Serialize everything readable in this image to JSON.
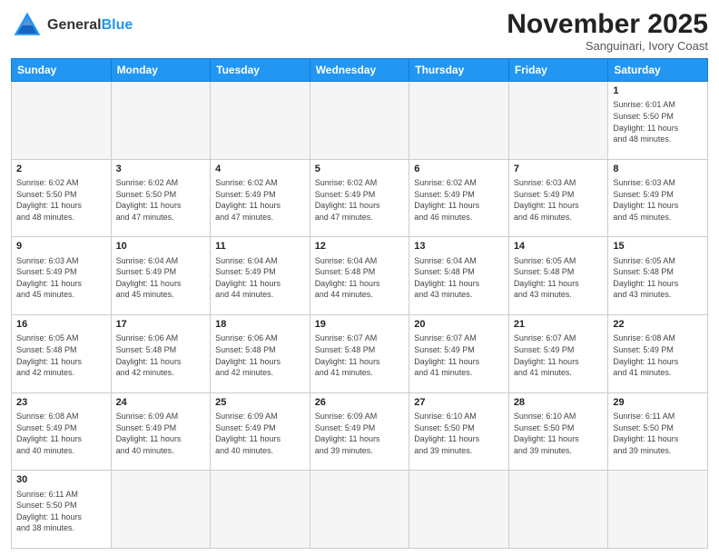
{
  "logo": {
    "general": "General",
    "blue": "Blue"
  },
  "header": {
    "month_title": "November 2025",
    "subtitle": "Sanguinari, Ivory Coast"
  },
  "days_of_week": [
    "Sunday",
    "Monday",
    "Tuesday",
    "Wednesday",
    "Thursday",
    "Friday",
    "Saturday"
  ],
  "weeks": [
    [
      {
        "day": "",
        "info": ""
      },
      {
        "day": "",
        "info": ""
      },
      {
        "day": "",
        "info": ""
      },
      {
        "day": "",
        "info": ""
      },
      {
        "day": "",
        "info": ""
      },
      {
        "day": "",
        "info": ""
      },
      {
        "day": "1",
        "info": "Sunrise: 6:01 AM\nSunset: 5:50 PM\nDaylight: 11 hours\nand 48 minutes."
      }
    ],
    [
      {
        "day": "2",
        "info": "Sunrise: 6:02 AM\nSunset: 5:50 PM\nDaylight: 11 hours\nand 48 minutes."
      },
      {
        "day": "3",
        "info": "Sunrise: 6:02 AM\nSunset: 5:50 PM\nDaylight: 11 hours\nand 47 minutes."
      },
      {
        "day": "4",
        "info": "Sunrise: 6:02 AM\nSunset: 5:49 PM\nDaylight: 11 hours\nand 47 minutes."
      },
      {
        "day": "5",
        "info": "Sunrise: 6:02 AM\nSunset: 5:49 PM\nDaylight: 11 hours\nand 47 minutes."
      },
      {
        "day": "6",
        "info": "Sunrise: 6:02 AM\nSunset: 5:49 PM\nDaylight: 11 hours\nand 46 minutes."
      },
      {
        "day": "7",
        "info": "Sunrise: 6:03 AM\nSunset: 5:49 PM\nDaylight: 11 hours\nand 46 minutes."
      },
      {
        "day": "8",
        "info": "Sunrise: 6:03 AM\nSunset: 5:49 PM\nDaylight: 11 hours\nand 45 minutes."
      }
    ],
    [
      {
        "day": "9",
        "info": "Sunrise: 6:03 AM\nSunset: 5:49 PM\nDaylight: 11 hours\nand 45 minutes."
      },
      {
        "day": "10",
        "info": "Sunrise: 6:04 AM\nSunset: 5:49 PM\nDaylight: 11 hours\nand 45 minutes."
      },
      {
        "day": "11",
        "info": "Sunrise: 6:04 AM\nSunset: 5:49 PM\nDaylight: 11 hours\nand 44 minutes."
      },
      {
        "day": "12",
        "info": "Sunrise: 6:04 AM\nSunset: 5:48 PM\nDaylight: 11 hours\nand 44 minutes."
      },
      {
        "day": "13",
        "info": "Sunrise: 6:04 AM\nSunset: 5:48 PM\nDaylight: 11 hours\nand 43 minutes."
      },
      {
        "day": "14",
        "info": "Sunrise: 6:05 AM\nSunset: 5:48 PM\nDaylight: 11 hours\nand 43 minutes."
      },
      {
        "day": "15",
        "info": "Sunrise: 6:05 AM\nSunset: 5:48 PM\nDaylight: 11 hours\nand 43 minutes."
      }
    ],
    [
      {
        "day": "16",
        "info": "Sunrise: 6:05 AM\nSunset: 5:48 PM\nDaylight: 11 hours\nand 42 minutes."
      },
      {
        "day": "17",
        "info": "Sunrise: 6:06 AM\nSunset: 5:48 PM\nDaylight: 11 hours\nand 42 minutes."
      },
      {
        "day": "18",
        "info": "Sunrise: 6:06 AM\nSunset: 5:48 PM\nDaylight: 11 hours\nand 42 minutes."
      },
      {
        "day": "19",
        "info": "Sunrise: 6:07 AM\nSunset: 5:48 PM\nDaylight: 11 hours\nand 41 minutes."
      },
      {
        "day": "20",
        "info": "Sunrise: 6:07 AM\nSunset: 5:49 PM\nDaylight: 11 hours\nand 41 minutes."
      },
      {
        "day": "21",
        "info": "Sunrise: 6:07 AM\nSunset: 5:49 PM\nDaylight: 11 hours\nand 41 minutes."
      },
      {
        "day": "22",
        "info": "Sunrise: 6:08 AM\nSunset: 5:49 PM\nDaylight: 11 hours\nand 41 minutes."
      }
    ],
    [
      {
        "day": "23",
        "info": "Sunrise: 6:08 AM\nSunset: 5:49 PM\nDaylight: 11 hours\nand 40 minutes."
      },
      {
        "day": "24",
        "info": "Sunrise: 6:09 AM\nSunset: 5:49 PM\nDaylight: 11 hours\nand 40 minutes."
      },
      {
        "day": "25",
        "info": "Sunrise: 6:09 AM\nSunset: 5:49 PM\nDaylight: 11 hours\nand 40 minutes."
      },
      {
        "day": "26",
        "info": "Sunrise: 6:09 AM\nSunset: 5:49 PM\nDaylight: 11 hours\nand 39 minutes."
      },
      {
        "day": "27",
        "info": "Sunrise: 6:10 AM\nSunset: 5:50 PM\nDaylight: 11 hours\nand 39 minutes."
      },
      {
        "day": "28",
        "info": "Sunrise: 6:10 AM\nSunset: 5:50 PM\nDaylight: 11 hours\nand 39 minutes."
      },
      {
        "day": "29",
        "info": "Sunrise: 6:11 AM\nSunset: 5:50 PM\nDaylight: 11 hours\nand 39 minutes."
      }
    ],
    [
      {
        "day": "30",
        "info": "Sunrise: 6:11 AM\nSunset: 5:50 PM\nDaylight: 11 hours\nand 38 minutes."
      },
      {
        "day": "",
        "info": ""
      },
      {
        "day": "",
        "info": ""
      },
      {
        "day": "",
        "info": ""
      },
      {
        "day": "",
        "info": ""
      },
      {
        "day": "",
        "info": ""
      },
      {
        "day": "",
        "info": ""
      }
    ]
  ]
}
